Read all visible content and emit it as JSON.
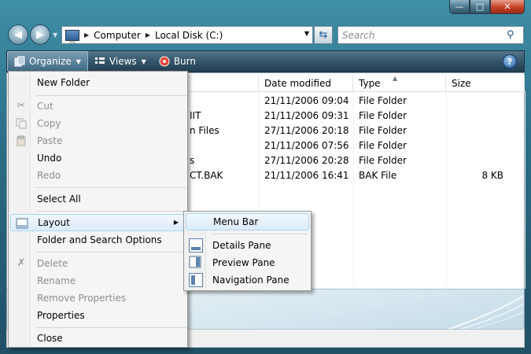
{
  "address": {
    "crumbs": [
      "Computer",
      "Local Disk (C:)"
    ]
  },
  "search": {
    "placeholder": "Search"
  },
  "toolbar": {
    "organize_label": "Organize",
    "views_label": "Views",
    "burn_label": "Burn"
  },
  "columns": {
    "date": "Date modified",
    "type": "Type",
    "size": "Size"
  },
  "rows": [
    {
      "name": "",
      "date": "21/11/2006 09:04",
      "type": "File Folder",
      "size": ""
    },
    {
      "name": "IIT",
      "date": "21/11/2006 09:31",
      "type": "File Folder",
      "size": ""
    },
    {
      "name": "n Files",
      "date": "27/11/2006 20:18",
      "type": "File Folder",
      "size": ""
    },
    {
      "name": "",
      "date": "21/11/2006 07:56",
      "type": "File Folder",
      "size": ""
    },
    {
      "name": "s",
      "date": "27/11/2006 20:28",
      "type": "File Folder",
      "size": ""
    },
    {
      "name": "CT.BAK",
      "date": "21/11/2006 16:41",
      "type": "BAK File",
      "size": "8 KB"
    }
  ],
  "organize_menu": {
    "new_folder": "New Folder",
    "cut": "Cut",
    "copy": "Copy",
    "paste": "Paste",
    "undo": "Undo",
    "redo": "Redo",
    "select_all": "Select All",
    "layout": "Layout",
    "folder_options": "Folder and Search Options",
    "delete": "Delete",
    "rename": "Rename",
    "remove_properties": "Remove Properties",
    "properties": "Properties",
    "close": "Close"
  },
  "layout_menu": {
    "menu_bar": "Menu Bar",
    "details_pane": "Details Pane",
    "preview_pane": "Preview Pane",
    "navigation_pane": "Navigation Pane"
  }
}
